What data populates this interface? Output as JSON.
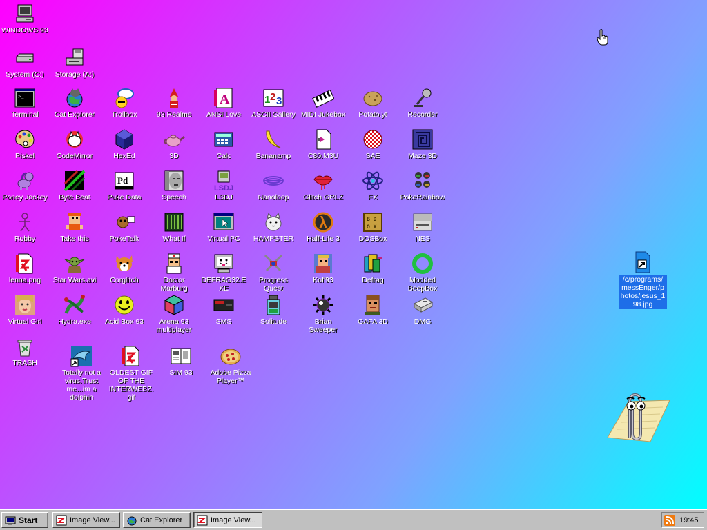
{
  "desktop": {
    "icons": [
      {
        "label": "WINDOWS 93",
        "icon": "computer-icon"
      },
      {
        "label": "System (C:)",
        "icon": "drive-icon"
      },
      {
        "label": "Storage (A:)",
        "icon": "floppy-drive-icon"
      },
      {
        "label": "Terminal",
        "icon": "terminal-icon"
      },
      {
        "label": "Cat Explorer",
        "icon": "cat-globe-icon"
      },
      {
        "label": "Trollbox",
        "icon": "chat-bubble-icon"
      },
      {
        "label": "93 Realms",
        "icon": "mage-icon"
      },
      {
        "label": "ANSI Love",
        "icon": "ansi-letter-icon"
      },
      {
        "label": "ASCII Gallery",
        "icon": "ascii-123-icon"
      },
      {
        "label": "MIDI Jukebox",
        "icon": "piano-keys-icon"
      },
      {
        "label": "Potato.yt",
        "icon": "potato-icon"
      },
      {
        "label": "Recorder",
        "icon": "microphone-icon"
      },
      {
        "label": "Piskel",
        "icon": "paint-palette-icon"
      },
      {
        "label": "CodeMirror",
        "icon": "white-cat-icon"
      },
      {
        "label": "HexEd",
        "icon": "hex-cube-icon"
      },
      {
        "label": "3D",
        "icon": "teapot-icon"
      },
      {
        "label": "Calc",
        "icon": "calculator-icon"
      },
      {
        "label": "Bananamp",
        "icon": "banana-icon"
      },
      {
        "label": "C80.M3U",
        "icon": "playlist-file-icon"
      },
      {
        "label": "SAE",
        "icon": "checkered-ball-icon"
      },
      {
        "label": "Maze 3D",
        "icon": "maze-icon"
      },
      {
        "label": "Poney Jockey",
        "icon": "pony-icon"
      },
      {
        "label": "Byte Beat",
        "icon": "byte-beat-icon"
      },
      {
        "label": "Puke Data",
        "icon": "pd-icon"
      },
      {
        "label": "Speech",
        "icon": "speech-face-icon"
      },
      {
        "label": "LSDJ",
        "icon": "gameboy-icon"
      },
      {
        "label": "Nanoloop",
        "icon": "nanoloop-icon"
      },
      {
        "label": "Glitch GRLZ",
        "icon": "lips-icon"
      },
      {
        "label": "FX",
        "icon": "atom-icon"
      },
      {
        "label": "PokeRainbow",
        "icon": "pokemon-trainers-icon"
      },
      {
        "label": "Robby",
        "icon": "stick-figure-icon"
      },
      {
        "label": "Take this",
        "icon": "clown-icon"
      },
      {
        "label": "PokeTalk",
        "icon": "poke-talk-icon"
      },
      {
        "label": "What If",
        "icon": "what-if-icon"
      },
      {
        "label": "Virtual PC",
        "icon": "virtual-pc-icon"
      },
      {
        "label": "HAMPSTER",
        "icon": "hamster-icon"
      },
      {
        "label": "Half-Life 3",
        "icon": "lambda-icon"
      },
      {
        "label": "DOSBox",
        "icon": "dosbox-icon"
      },
      {
        "label": "NES",
        "icon": "nes-console-icon"
      },
      {
        "label": "lenna.png",
        "icon": "image-file-icon"
      },
      {
        "label": "Star Wars.avi",
        "icon": "yoda-icon"
      },
      {
        "label": "Corglitch",
        "icon": "corgi-icon"
      },
      {
        "label": "Doctor Marburg",
        "icon": "doctor-icon"
      },
      {
        "label": "DEFRAG32.EXE",
        "icon": "monitor-face-icon"
      },
      {
        "label": "Progress Quest",
        "icon": "crossed-swords-icon"
      },
      {
        "label": "Kof'93",
        "icon": "fighter-icon"
      },
      {
        "label": "Defrag",
        "icon": "defrag-icon"
      },
      {
        "label": "Modded BeepBox",
        "icon": "green-ring-icon"
      },
      {
        "label": "Virtual Girl",
        "icon": "girl-face-icon"
      },
      {
        "label": "Hydra.exe",
        "icon": "hydra-icon"
      },
      {
        "label": "Acid Box 93",
        "icon": "smiley-icon"
      },
      {
        "label": "Arena 93 multiplayer",
        "icon": "cube-icon"
      },
      {
        "label": "SMS",
        "icon": "sms-console-icon"
      },
      {
        "label": "Solitude",
        "icon": "solitude-icon"
      },
      {
        "label": "Brian Sweeper",
        "icon": "mine-icon"
      },
      {
        "label": "GAFA 3D",
        "icon": "gafa-face-icon"
      },
      {
        "label": "DMG",
        "icon": "dmg-icon"
      },
      {
        "label": "TRASH",
        "icon": "trash-icon"
      },
      {
        "label": "Totally not a virus.Trust me...im a dolphin",
        "icon": "dolphin-shortcut-icon"
      },
      {
        "label": "OLDEST GIF OF THE INTERWEBZ.gif",
        "icon": "gif-file-icon"
      },
      {
        "label": "SIM 93",
        "icon": "sim-book-icon"
      },
      {
        "label": "Adobe Pizza Player™",
        "icon": "pizza-icon"
      }
    ],
    "selected_file": {
      "label": "/c/programs/messEnger/photos/jesus_198.jpg",
      "icon": "file-shortcut-icon"
    },
    "assistant": {
      "icon": "paperclip-assistant-icon"
    },
    "cursor": {
      "icon": "hand-cursor-icon"
    }
  },
  "taskbar": {
    "start_label": "Start",
    "tasks": [
      {
        "label": "Image View...",
        "icon": "image-viewer-icon"
      },
      {
        "label": "Cat Explorer",
        "icon": "cat-globe-icon"
      },
      {
        "label": "Image View...",
        "icon": "image-viewer-icon"
      }
    ],
    "clock": "19:45",
    "tray_icon": "rss-icon",
    "colors": {
      "face": "#c0c0c0",
      "selection": "#1e6ee8"
    }
  }
}
